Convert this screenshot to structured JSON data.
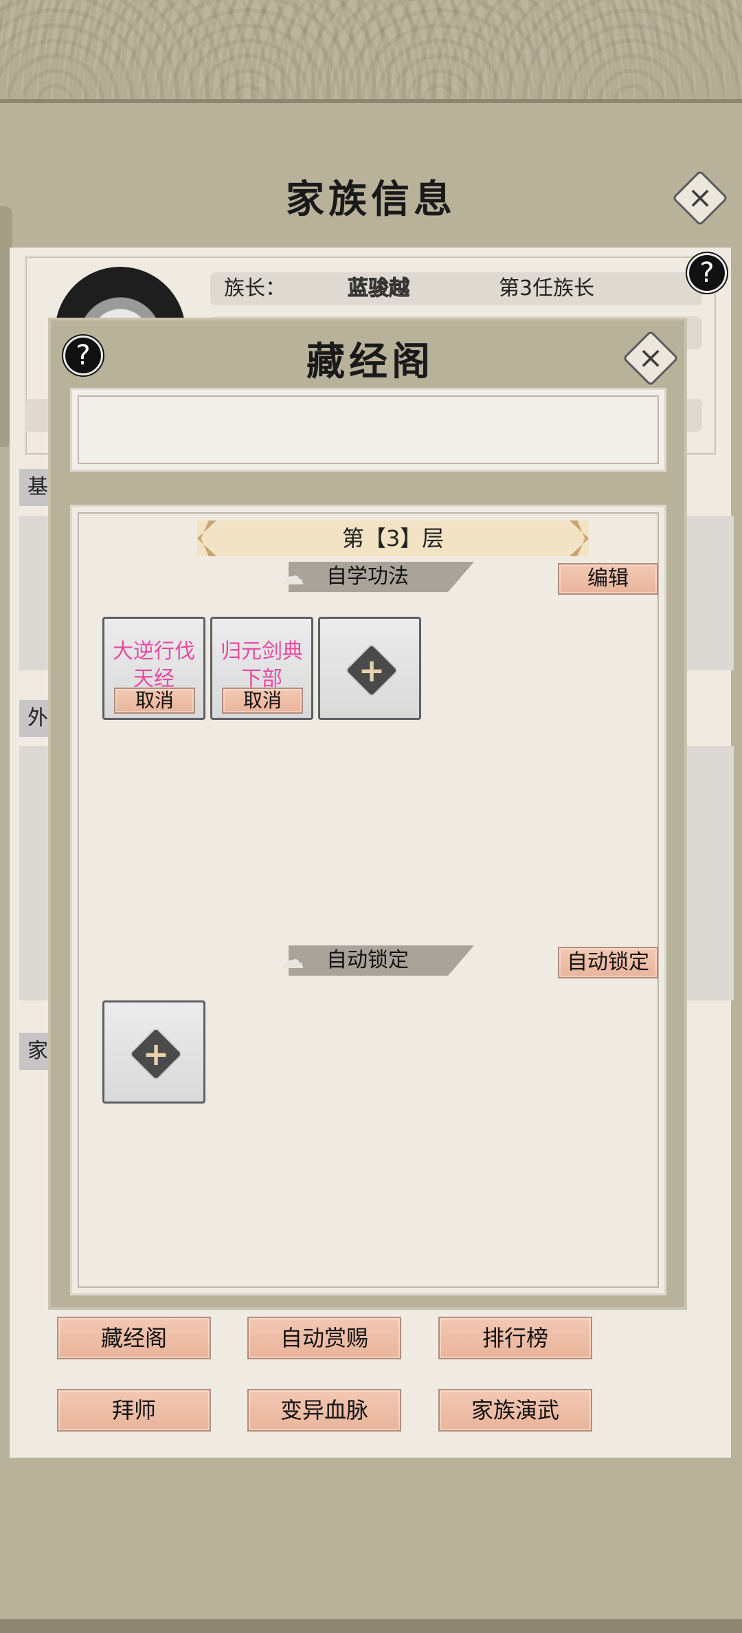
{
  "family_page": {
    "title": "家族信息",
    "leader_label": "族长：",
    "leader_name": "蓝骏越",
    "leader_generation": "第3任族长",
    "side_tabs": [
      "基",
      "外",
      "家"
    ],
    "buttons": [
      "藏经阁",
      "自动赏赐",
      "排行榜",
      "拜师",
      "变异血脉",
      "家族演武"
    ]
  },
  "sutra_modal": {
    "title": "藏经阁",
    "help_icon": "?",
    "close_icon": "×",
    "floor_label": "第【3】层",
    "self_study": {
      "header": "自学功法",
      "edit_button": "编辑",
      "slots": [
        {
          "name": "大逆行伐天经",
          "cancel": "取消"
        },
        {
          "name": "归元剑典下部",
          "cancel": "取消"
        }
      ]
    },
    "auto_lock": {
      "header": "自动锁定",
      "button": "自动锁定"
    }
  },
  "icons": {
    "help": "question-icon",
    "close": "close-icon",
    "add": "plus-icon",
    "cloud": "cloud-icon"
  },
  "colors": {
    "background": "#b9b29a",
    "panel": "#efebe2",
    "button": "#f3c8b3",
    "technique_name": "#e64aa2",
    "leader_name": "#f5e01a"
  }
}
